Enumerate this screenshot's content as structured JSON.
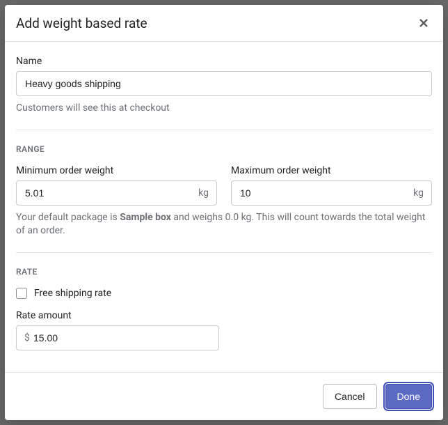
{
  "modal": {
    "title": "Add weight based rate"
  },
  "name": {
    "label": "Name",
    "value": "Heavy goods shipping",
    "help": "Customers will see this at checkout"
  },
  "range": {
    "heading": "RANGE",
    "min_label": "Minimum order weight",
    "min_value": "5.01",
    "max_label": "Maximum order weight",
    "max_value": "10",
    "unit": "kg",
    "package_text_prefix": "Your default package is ",
    "package_name": "Sample box",
    "package_text_suffix": " and weighs 0.0 kg. This will count towards the total weight of an order."
  },
  "rate": {
    "heading": "RATE",
    "free_label": "Free shipping rate",
    "amount_label": "Rate amount",
    "currency": "$",
    "amount_value": "15.00"
  },
  "footer": {
    "cancel": "Cancel",
    "done": "Done"
  }
}
